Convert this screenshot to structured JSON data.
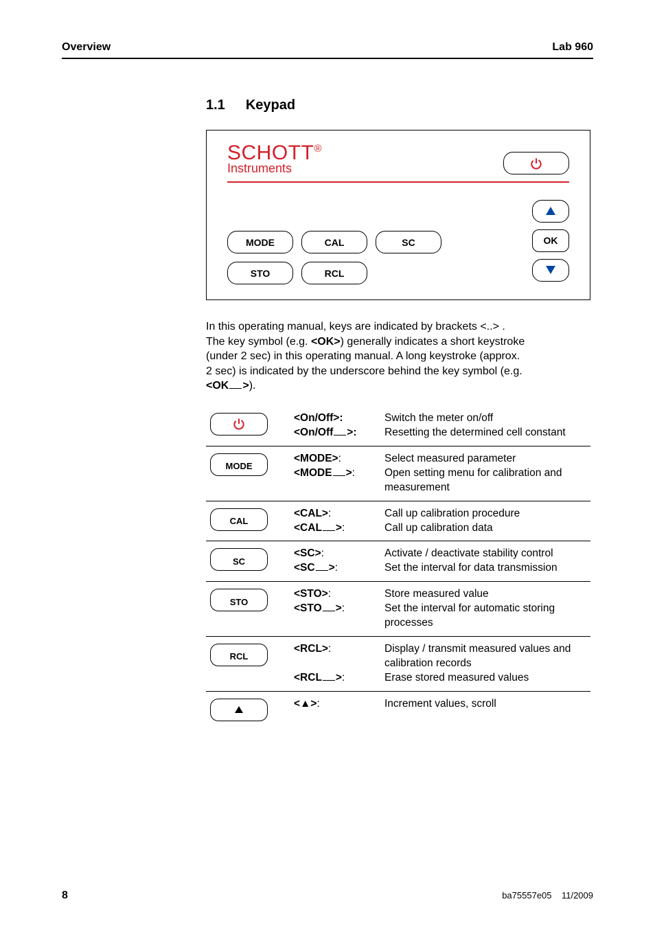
{
  "header": {
    "left": "Overview",
    "right": "Lab 960"
  },
  "section": {
    "num": "1.1",
    "title": "Keypad"
  },
  "keypad": {
    "brand_main": "SCHOTT",
    "brand_reg": "®",
    "brand_sub": "Instruments",
    "keys": {
      "mode": "MODE",
      "cal": "CAL",
      "sc": "SC",
      "sto": "STO",
      "rcl": "RCL",
      "ok": "OK"
    }
  },
  "paragraph": {
    "l1": "In this operating manual, keys are indicated by brackets <..> .",
    "l2a": "The key symbol (e.g. ",
    "l2b": "<OK>",
    "l2c": ") generally indicates a short keystroke",
    "l3": "(under 2 sec) in this operating manual. A long keystroke (approx.",
    "l4": "2 sec) is indicated by the underscore behind the key symbol (e.g.",
    "l5a": "<OK",
    "l5b": ">",
    "l5c": ")."
  },
  "rows": [
    {
      "short": "<On/Off>:",
      "long_pre": "<On/Off",
      "long_post": ">:",
      "d1": "Switch the meter on/off",
      "d2": "Resetting the determined cell constant"
    },
    {
      "icon": "MODE",
      "short": "<MODE>",
      "long_pre": "<MODE",
      "long_post": ">",
      "d1": "Select measured parameter",
      "d2": "Open setting menu for calibration and measurement"
    },
    {
      "icon": "CAL",
      "short": "<CAL>",
      "long_pre": "<CAL",
      "long_post": ">",
      "d1": "Call up calibration procedure",
      "d2": "Call up calibration data"
    },
    {
      "icon": "SC",
      "short": "<SC>",
      "long_pre": "<SC",
      "long_post": ">",
      "d1": "Activate / deactivate stability control",
      "d2": "Set the interval for data transmission"
    },
    {
      "icon": "STO",
      "short": "<STO>",
      "long_pre": "<STO",
      "long_post": ">",
      "d1": "Store measured value",
      "d2": "Set the interval for automatic storing processes"
    },
    {
      "icon": "RCL",
      "short": "<RCL>",
      "long_pre": "<RCL",
      "long_post": ">",
      "d1": "Display / transmit measured values and calibration records",
      "d2": "Erase stored measured values"
    },
    {
      "short": "<▲>",
      "d1": "Increment values, scroll"
    }
  ],
  "footer": {
    "page": "8",
    "docid": "ba75557e05",
    "date": "11/2009"
  }
}
